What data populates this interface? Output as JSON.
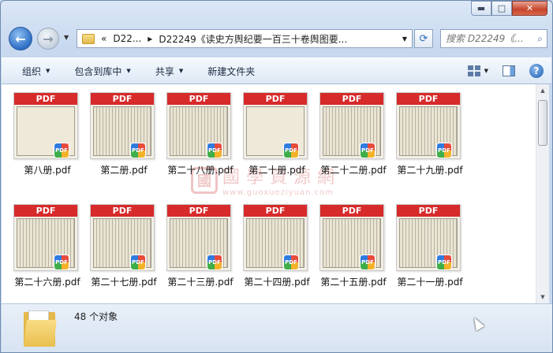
{
  "window": {
    "caption": {
      "minimize": "▬",
      "maximize": "□",
      "close": "✕"
    }
  },
  "nav": {
    "back_glyph": "←",
    "forward_glyph": "→",
    "breadcrumb": [
      {
        "label": "«"
      },
      {
        "label": "D22..."
      },
      {
        "label": "▸"
      },
      {
        "label": "D22249《读史方舆纪要一百三十卷舆图要..."
      }
    ],
    "refresh_glyph": "⟳",
    "search_placeholder": "搜索 D22249《...",
    "search_icon": "search-icon"
  },
  "toolbar": {
    "organize": "组织",
    "include_library": "包含到库中",
    "share": "共享",
    "new_folder": "新建文件夹"
  },
  "files": [
    {
      "name": "第八册.pdf",
      "page": "light"
    },
    {
      "name": "第二册.pdf",
      "page": "dense"
    },
    {
      "name": "第二十八册.pdf",
      "page": "dense"
    },
    {
      "name": "第二十册.pdf",
      "page": "light"
    },
    {
      "name": "第二十二册.pdf",
      "page": "dense"
    },
    {
      "name": "第二十九册.pdf",
      "page": "dense"
    },
    {
      "name": "第二十六册.pdf",
      "page": "dense"
    },
    {
      "name": "第二十七册.pdf",
      "page": "dense"
    },
    {
      "name": "第二十三册.pdf",
      "page": "dense"
    },
    {
      "name": "第二十四册.pdf",
      "page": "dense"
    },
    {
      "name": "第二十五册.pdf",
      "page": "dense"
    },
    {
      "name": "第二十一册.pdf",
      "page": "dense"
    }
  ],
  "thumb_banner": "PDF",
  "watermark": {
    "seal": "國",
    "text": "國學資源網",
    "url": "www.guoxueziyuan.com"
  },
  "details": {
    "count": "48 个对象"
  },
  "colors": {
    "pdf_banner": "#d72a2a",
    "accent": "#2d6fc4"
  }
}
